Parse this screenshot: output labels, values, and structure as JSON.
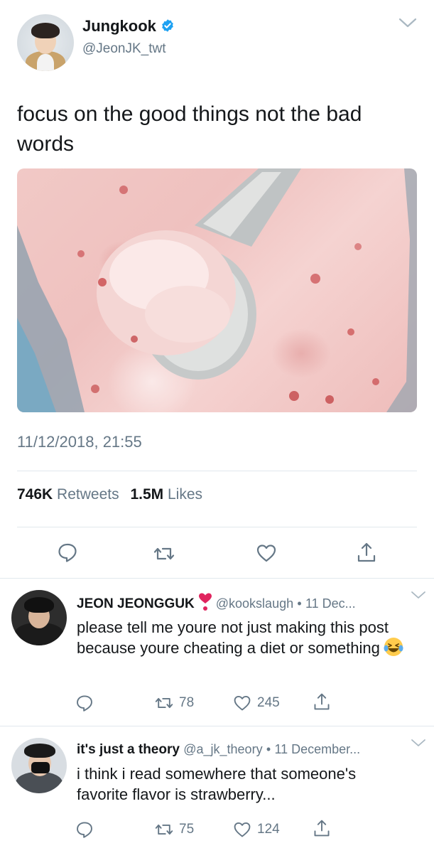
{
  "tweet": {
    "author": {
      "name": "Jungkook",
      "handle": "@JeonJK_twt",
      "verified": true
    },
    "text": "focus on the good things not the bad words",
    "media": {
      "kind": "photo",
      "subject": "strawberry ice cream with scoop"
    },
    "timestamp": "11/12/2018, 21:55",
    "stats": {
      "retweets_count": "746K",
      "retweets_label": "Retweets",
      "likes_count": "1.5M",
      "likes_label": "Likes"
    },
    "actions": [
      "reply-icon",
      "retweet-icon",
      "like-icon",
      "share-icon"
    ]
  },
  "replies": [
    {
      "name": "JEON JEONGGUK",
      "badge_icon": "red-heart-icon",
      "handle": "@kookslaugh",
      "separator": "•",
      "date": "11 Dec...",
      "text": "please tell me youre not just making this post because youre cheating a diet or something",
      "emoji_icon": "laughing-emoji-icon",
      "retweets": "78",
      "likes": "245"
    },
    {
      "name": "it's just a theory",
      "handle": "@a_jk_theory",
      "separator": "•",
      "date": "11 December...",
      "text": "i think i read somewhere that someone's favorite flavor is strawberry...",
      "retweets": "75",
      "likes": "124"
    }
  ],
  "colors": {
    "text_primary": "#14171a",
    "text_secondary": "#657786",
    "divider": "#e1e8ed",
    "verified_blue": "#1da1f2",
    "heart_red": "#e0245e"
  }
}
